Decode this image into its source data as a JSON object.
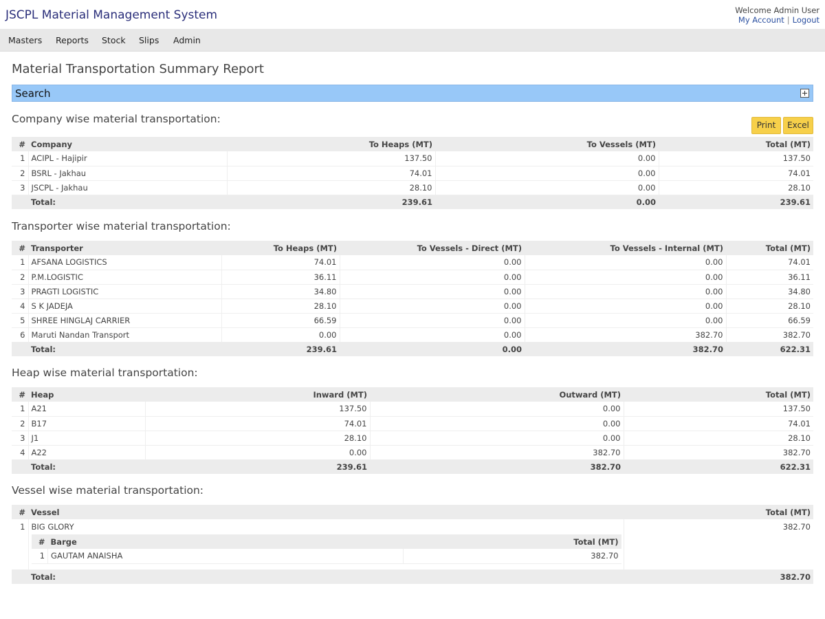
{
  "header": {
    "app_title": "JSCPL Material Management System",
    "welcome": "Welcome Admin User",
    "my_account": "My Account",
    "separator": "|",
    "logout": "Logout"
  },
  "menu": [
    "Masters",
    "Reports",
    "Stock",
    "Slips",
    "Admin"
  ],
  "page_title": "Material Transportation Summary Report",
  "search": {
    "label": "Search",
    "icon": "plus-square-icon"
  },
  "actions": {
    "print": "Print",
    "excel": "Excel"
  },
  "colors": {
    "search_bar": "#98c8f8",
    "button": "#f7d04a",
    "title": "#2a2e7a"
  },
  "company": {
    "title": "Company wise material transportation:",
    "headers": [
      "#",
      "Company",
      "To Heaps (MT)",
      "To Vessels (MT)",
      "Total (MT)"
    ],
    "rows": [
      [
        "1",
        "ACIPL - Hajipir",
        "137.50",
        "0.00",
        "137.50"
      ],
      [
        "2",
        "BSRL - Jakhau",
        "74.01",
        "0.00",
        "74.01"
      ],
      [
        "3",
        "JSCPL - Jakhau",
        "28.10",
        "0.00",
        "28.10"
      ]
    ],
    "total": [
      "Total:",
      "239.61",
      "0.00",
      "239.61"
    ]
  },
  "transporter": {
    "title": "Transporter wise material transportation:",
    "headers": [
      "#",
      "Transporter",
      "To Heaps (MT)",
      "To Vessels - Direct (MT)",
      "To Vessels - Internal (MT)",
      "Total (MT)"
    ],
    "rows": [
      [
        "1",
        "AFSANA LOGISTICS",
        "74.01",
        "0.00",
        "0.00",
        "74.01"
      ],
      [
        "2",
        "P.M.LOGISTIC",
        "36.11",
        "0.00",
        "0.00",
        "36.11"
      ],
      [
        "3",
        "PRAGTI LOGISTIC",
        "34.80",
        "0.00",
        "0.00",
        "34.80"
      ],
      [
        "4",
        "S K JADEJA",
        "28.10",
        "0.00",
        "0.00",
        "28.10"
      ],
      [
        "5",
        "SHREE HINGLAJ CARRIER",
        "66.59",
        "0.00",
        "0.00",
        "66.59"
      ],
      [
        "6",
        "Maruti Nandan Transport",
        "0.00",
        "0.00",
        "382.70",
        "382.70"
      ]
    ],
    "total": [
      "Total:",
      "239.61",
      "0.00",
      "382.70",
      "622.31"
    ]
  },
  "heap": {
    "title": "Heap wise material transportation:",
    "headers": [
      "#",
      "Heap",
      "Inward (MT)",
      "Outward (MT)",
      "Total (MT)"
    ],
    "rows": [
      [
        "1",
        "A21",
        "137.50",
        "0.00",
        "137.50"
      ],
      [
        "2",
        "B17",
        "74.01",
        "0.00",
        "74.01"
      ],
      [
        "3",
        "J1",
        "28.10",
        "0.00",
        "28.10"
      ],
      [
        "4",
        "A22",
        "0.00",
        "382.70",
        "382.70"
      ]
    ],
    "total": [
      "Total:",
      "239.61",
      "382.70",
      "622.31"
    ]
  },
  "vessel": {
    "title": "Vessel wise material transportation:",
    "headers": [
      "#",
      "Vessel",
      "Total (MT)"
    ],
    "rows": [
      {
        "idx": "1",
        "name": "BIG GLORY",
        "total": "382.70",
        "barge_headers": [
          "#",
          "Barge",
          "Total (MT)"
        ],
        "barges": [
          [
            "1",
            "GAUTAM ANAISHA",
            "382.70"
          ]
        ]
      }
    ],
    "total": [
      "Total:",
      "382.70"
    ]
  }
}
